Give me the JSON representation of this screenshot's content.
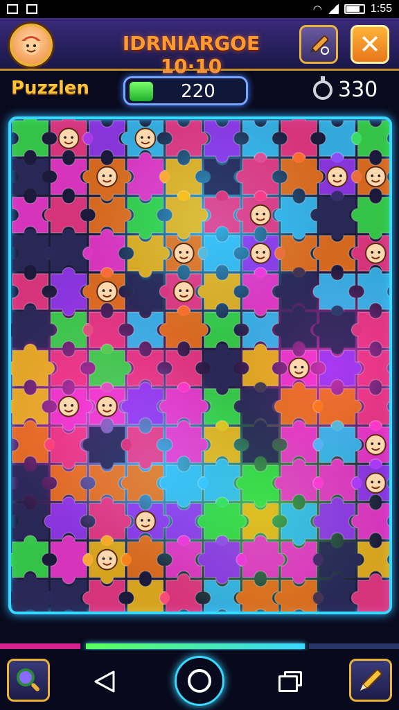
{
  "status_bar": {
    "time": "1:55"
  },
  "header": {
    "title": "IDRNIARGOE 10·10",
    "avatar_icon": "kid-face-icon",
    "edit_icon": "pencil-icon",
    "close_icon": "close-icon"
  },
  "stats": {
    "label": "Puzzlen",
    "score": "220",
    "timer": "330"
  },
  "board": {
    "cols": 10,
    "rows": 13,
    "piece_colors": [
      "#ff3a8a",
      "#ff7a1a",
      "#ffc21a",
      "#3ae84a",
      "#3ac8ff",
      "#a03aff",
      "#ff3ad8",
      "#2a2a5a"
    ]
  },
  "progress": {
    "fill_fraction": 0.7
  },
  "bottom_bar": {
    "left_button_icon": "magnifier-icon",
    "right_button_icon": "pencil-icon",
    "nav_back_icon": "back-triangle-icon",
    "nav_home_icon": "home-circle-icon",
    "nav_recent_icon": "recent-apps-icon"
  }
}
